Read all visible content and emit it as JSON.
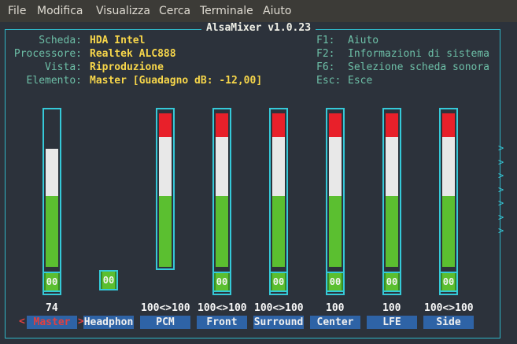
{
  "menu": [
    "File",
    "Modifica",
    "Visualizza",
    "Cerca",
    "Terminale",
    "Aiuto"
  ],
  "title": "AlsaMixer v1.0.23",
  "info": [
    {
      "label": "Scheda:",
      "value": "HDA Intel"
    },
    {
      "label": "Processore:",
      "value": "Realtek ALC888"
    },
    {
      "label": "Vista:",
      "value": "Riproduzione"
    },
    {
      "label": "Elemento:",
      "value": "Master [Guadagno dB: -12,00]"
    }
  ],
  "keys": [
    {
      "key": "F1:",
      "desc": "Aiuto"
    },
    {
      "key": "F2:",
      "desc": "Informazioni di sistema"
    },
    {
      "key": "F6:",
      "desc": "Selezione scheda sonora"
    },
    {
      "key": "Esc:",
      "desc": "Esce"
    }
  ],
  "mute_label": "00",
  "right_arrow": ">",
  "selected_markers": {
    "left": "<",
    "right": ">"
  },
  "channels": [
    {
      "name": "Master",
      "percent": "74",
      "level": 0.74,
      "has_bar": true,
      "selected": true
    },
    {
      "name": "Headphon",
      "percent": "",
      "level": 0,
      "has_bar": false,
      "selected": false
    },
    {
      "name": "PCM",
      "percent": "100<>100",
      "level": 1.0,
      "has_bar": true,
      "short": true,
      "selected": false
    },
    {
      "name": "Front",
      "percent": "100<>100",
      "level": 1.0,
      "has_bar": true,
      "selected": false
    },
    {
      "name": "Surround",
      "percent": "100<>100",
      "level": 1.0,
      "has_bar": true,
      "selected": false
    },
    {
      "name": "Center",
      "percent": "100",
      "level": 1.0,
      "has_bar": true,
      "selected": false
    },
    {
      "name": "LFE",
      "percent": "100",
      "level": 1.0,
      "has_bar": true,
      "selected": false
    },
    {
      "name": "Side",
      "percent": "100<>100",
      "level": 1.0,
      "has_bar": true,
      "selected": false
    }
  ]
}
